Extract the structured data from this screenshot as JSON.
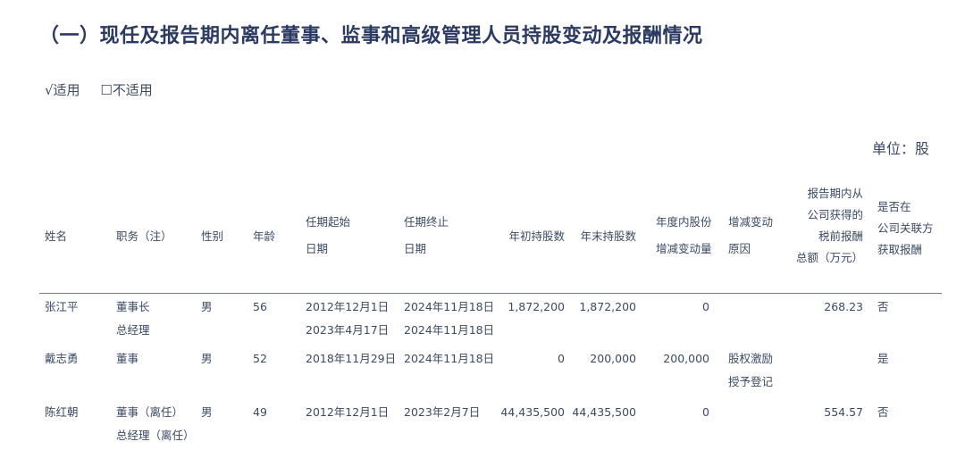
{
  "title": "（一）现任及报告期内离任董事、监事和高级管理人员持股变动及报酬情况",
  "applicable": {
    "yes": "√适用",
    "no": "☐不适用"
  },
  "unit": "单位：股",
  "headers": {
    "name": "姓名",
    "position": "职务（注）",
    "gender": "性别",
    "age": "年龄",
    "start": [
      "任期起始",
      "日期"
    ],
    "end": [
      "任期终止",
      "日期"
    ],
    "begin_shares": "年初持股数",
    "end_shares": "年末持股数",
    "change": [
      "年度内股份",
      "增减变动量"
    ],
    "reason": [
      "增减变动",
      "原因"
    ],
    "pay": [
      "报告期内从",
      "公司获得的",
      "税前报酬",
      "总额（万元）"
    ],
    "related": [
      "是否在",
      "公司关联方",
      "获取报酬"
    ]
  },
  "rows": [
    {
      "name": "张江平",
      "position": [
        "董事长",
        "总经理"
      ],
      "gender": "男",
      "age": "56",
      "start": [
        "2012年12月1日",
        "2023年4月17日"
      ],
      "end": [
        "2024年11月18日",
        "2024年11月18日"
      ],
      "begin_shares": "1,872,200",
      "end_shares": "1,872,200",
      "change": "0",
      "reason": [],
      "pay": "268.23",
      "related": "否"
    },
    {
      "name": "戴志勇",
      "position": [
        "董事"
      ],
      "gender": "男",
      "age": "52",
      "start": [
        "2018年11月29日"
      ],
      "end": [
        "2024年11月18日"
      ],
      "begin_shares": "0",
      "end_shares": "200,000",
      "change": "200,000",
      "reason": [
        "股权激励",
        "授予登记"
      ],
      "pay": "",
      "related": "是"
    },
    {
      "name": "陈红朝",
      "position": [
        "董事（离任）",
        "总经理（离任）"
      ],
      "gender": "男",
      "age": "49",
      "start": [
        "2012年12月1日"
      ],
      "end": [
        "2023年2月7日"
      ],
      "begin_shares": "44,435,500",
      "end_shares": "44,435,500",
      "change": "0",
      "reason": [],
      "pay": "554.57",
      "related": "否"
    }
  ]
}
